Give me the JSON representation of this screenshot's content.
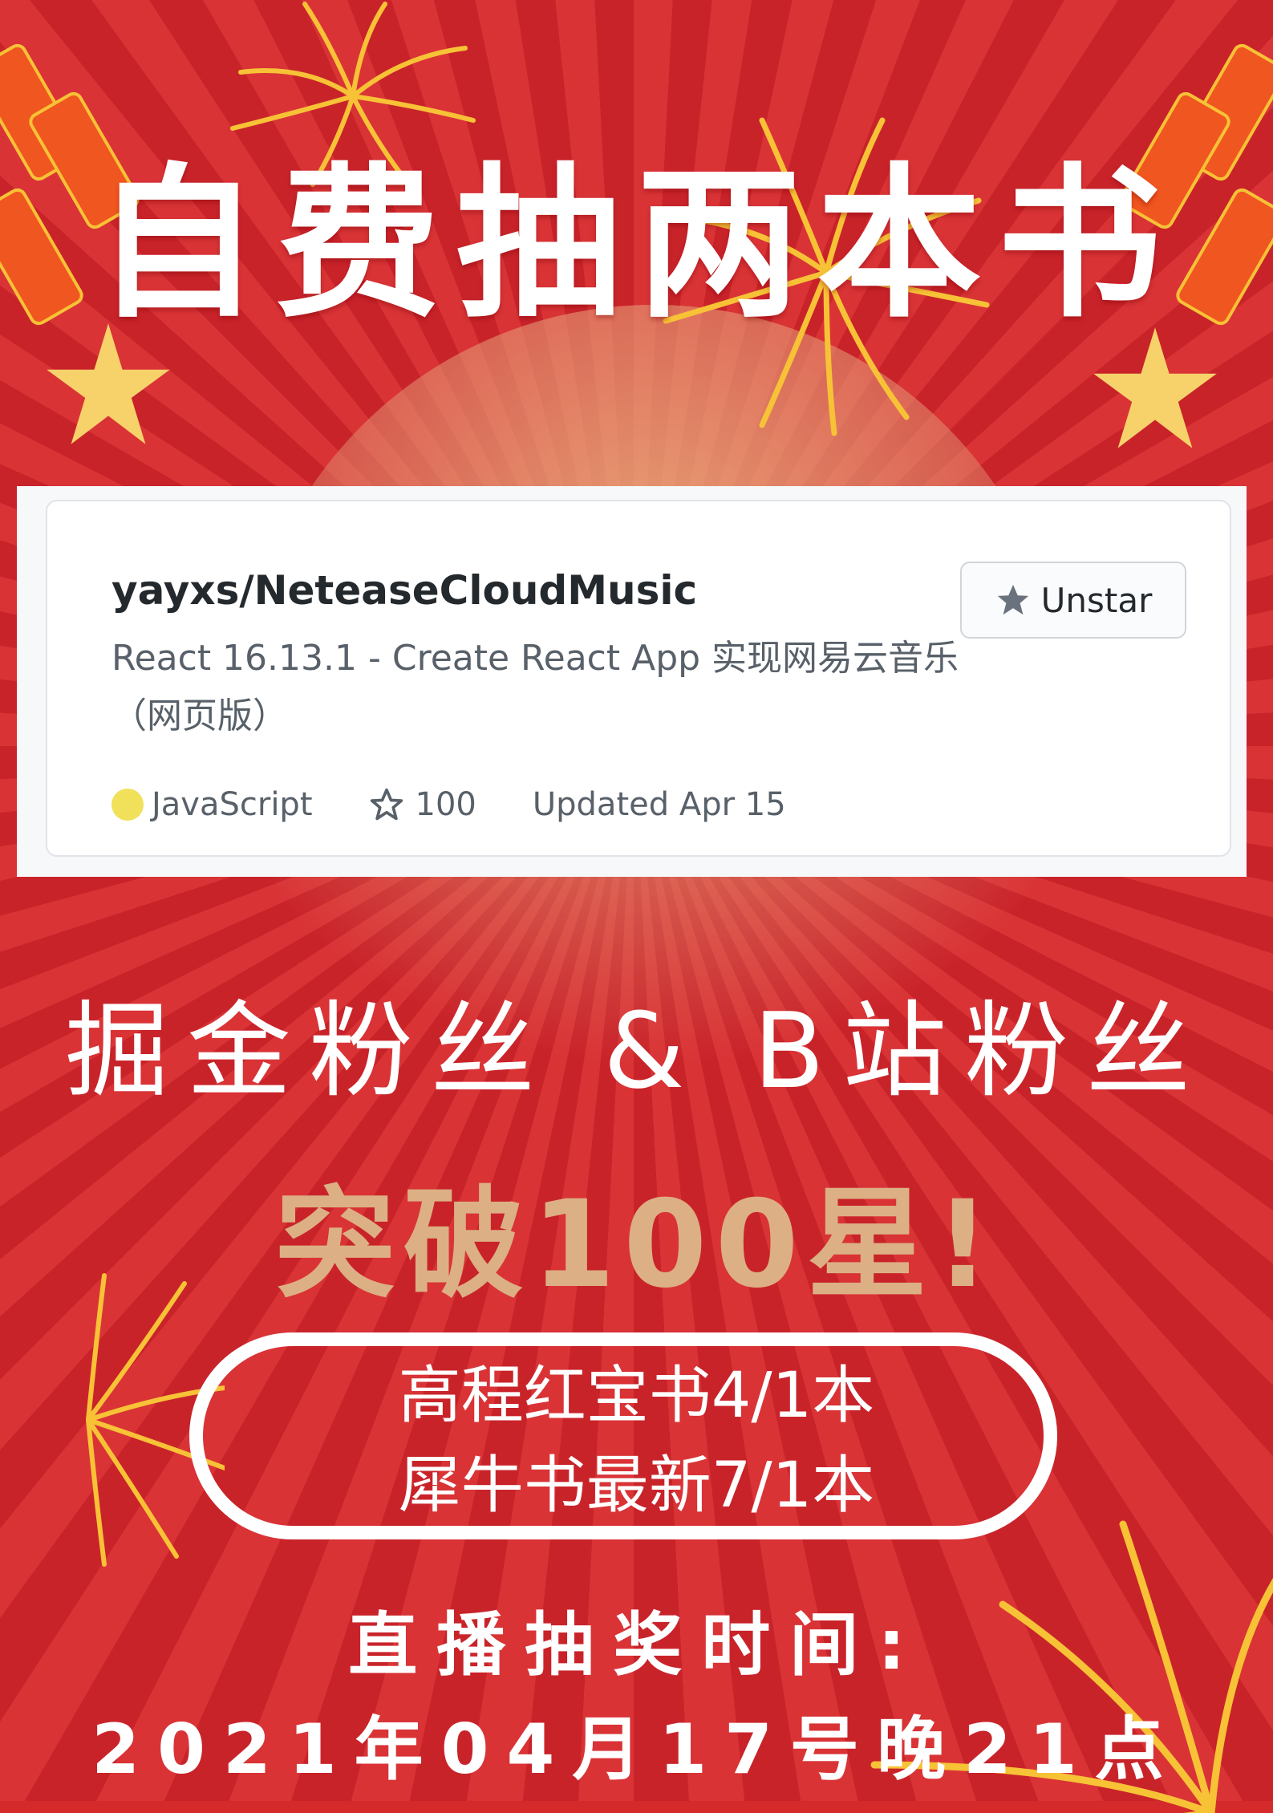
{
  "poster": {
    "headline": "自费抽两本书",
    "fans_line": "掘金粉丝 & B站粉丝",
    "milestone": "突破100星!",
    "prizes": [
      "高程红宝书4/1本",
      "犀牛书最新7/1本"
    ],
    "draw_label": "直播抽奖时间:",
    "draw_time": "2021年04月17号晚21点"
  },
  "repo_card": {
    "name": "yayxs/NeteaseCloudMusic",
    "description": "React 16.13.1 - Create React App 实现网易云音乐（网页版）",
    "language": "JavaScript",
    "language_color": "#f1e05a",
    "stars": "100",
    "updated": "Updated Apr 15",
    "star_button": "Unstar"
  },
  "colors": {
    "background": "#d42a2c",
    "milestone": "#dcb084"
  }
}
